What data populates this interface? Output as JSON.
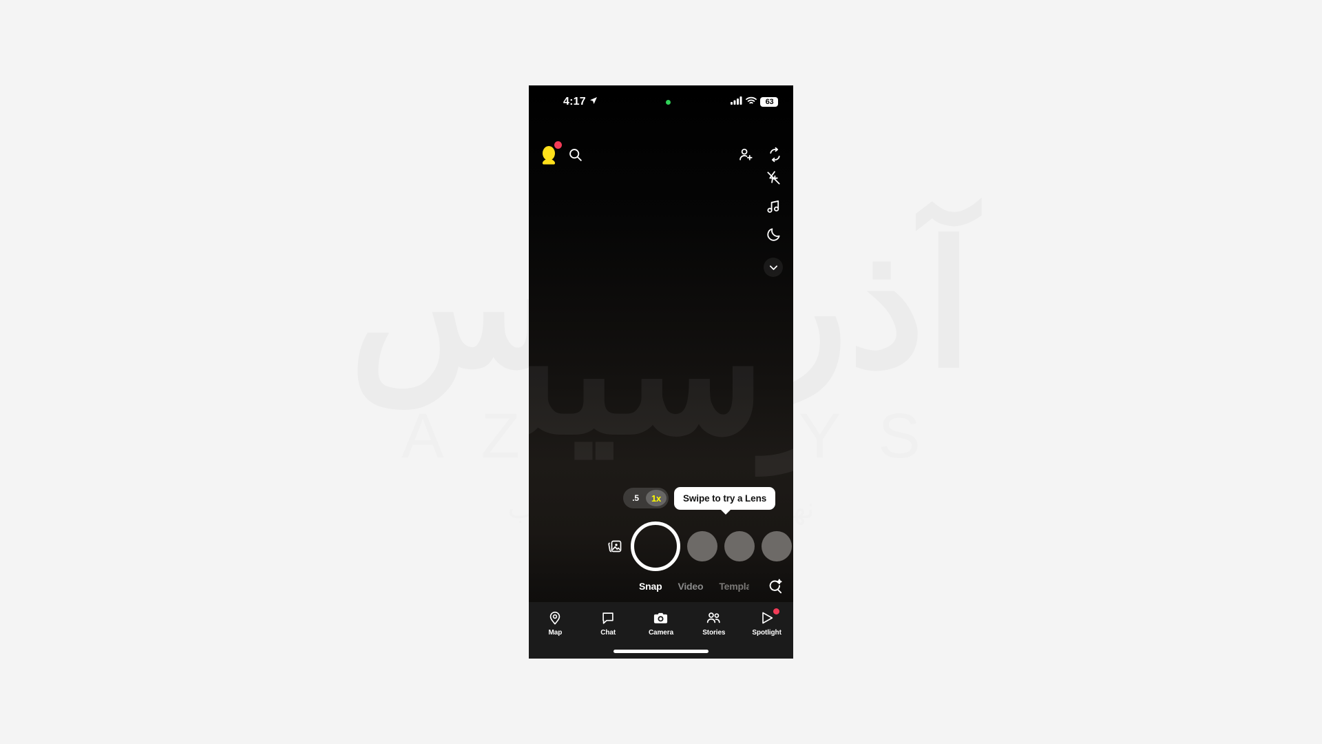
{
  "watermark": {
    "logo": "آذرسیس",
    "name": "AZARSYS",
    "tagline": "نهایت سرعت میزبانی وب"
  },
  "status_bar": {
    "time": "4:17",
    "location_icon": "location-arrow-icon",
    "privacy_dot": "green-recording-dot",
    "cellular_icon": "cellular-signal-icon",
    "wifi_icon": "wifi-icon",
    "battery_level": "63"
  },
  "top_bar": {
    "profile_icon": "bitmoji-avatar-icon",
    "profile_badge": "unread-dot",
    "search_icon": "search-icon",
    "add_friend_icon": "add-friend-icon",
    "flip_camera_icon": "flip-camera-icon"
  },
  "tool_rail": {
    "items": [
      {
        "name": "flash-off-icon",
        "label": "Flash Off"
      },
      {
        "name": "music-icon",
        "label": "Music"
      },
      {
        "name": "night-mode-icon",
        "label": "Night Mode"
      }
    ],
    "collapse_icon": "chevron-down-icon"
  },
  "zoom_control": {
    "options": [
      {
        "value": ".5",
        "active": false
      },
      {
        "value": "1x",
        "active": true
      }
    ],
    "active_color": "#fffc00"
  },
  "lens_tooltip": {
    "text": "Swipe to try a Lens"
  },
  "capture": {
    "memories_icon": "memories-stack-icon",
    "shutter_icon": "shutter-button",
    "lens_count": 3
  },
  "modes": {
    "tabs": [
      {
        "label": "Snap",
        "active": true,
        "clipped": false
      },
      {
        "label": "Video",
        "active": false,
        "clipped": false
      },
      {
        "label": "Templates",
        "active": false,
        "clipped": true
      }
    ],
    "explore_icon": "lens-explore-icon"
  },
  "bottom_nav": {
    "items": [
      {
        "label": "Map",
        "icon": "map-pin-icon",
        "active": false,
        "badge": false
      },
      {
        "label": "Chat",
        "icon": "chat-bubble-icon",
        "active": false,
        "badge": false
      },
      {
        "label": "Camera",
        "icon": "camera-icon",
        "active": true,
        "badge": false
      },
      {
        "label": "Stories",
        "icon": "stories-people-icon",
        "active": false,
        "badge": false
      },
      {
        "label": "Spotlight",
        "icon": "spotlight-play-icon",
        "active": false,
        "badge": true
      }
    ],
    "badge_color": "#f23b57"
  }
}
